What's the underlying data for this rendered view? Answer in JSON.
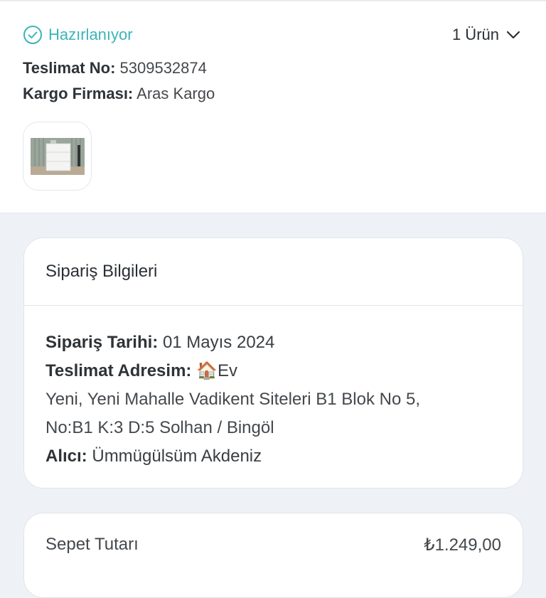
{
  "shipment": {
    "status": "Hazırlanıyor",
    "item_count": "1 Ürün",
    "delivery_no_label": "Teslimat No:",
    "delivery_no": "5309532874",
    "carrier_label": "Kargo Firması:",
    "carrier": "Aras Kargo"
  },
  "order_info": {
    "title": "Sipariş Bilgileri",
    "date_label": "Sipariş Tarihi:",
    "date": "01 Mayıs 2024",
    "address_label": "Teslimat Adresim:",
    "address_icon": "🏠",
    "address_name": "Ev",
    "address_line1": "Yeni, Yeni Mahalle Vadikent Siteleri B1 Blok No 5,",
    "address_line2": "No:B1 K:3 D:5 Solhan / Bingöl",
    "recipient_label": "Alıcı:",
    "recipient": "Ümmügülsüm Akdeniz"
  },
  "summary": {
    "basket_label": "Sepet Tutarı",
    "basket_amount": "₺1.249,00"
  },
  "colors": {
    "status_accent": "#3cb4b8",
    "page_bg": "#eef2f6"
  }
}
